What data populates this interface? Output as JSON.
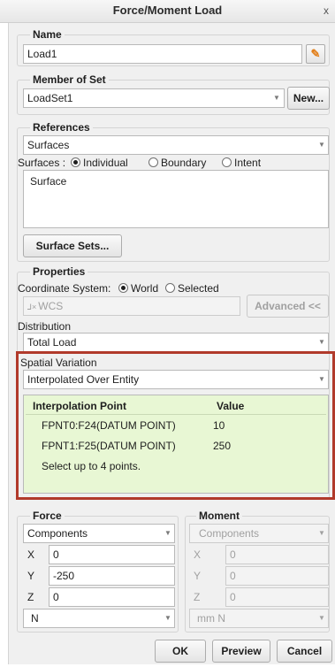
{
  "window": {
    "title": "Force/Moment Load",
    "close": "x"
  },
  "name_group": {
    "legend": "Name",
    "value": "Load1"
  },
  "member_group": {
    "legend": "Member of Set",
    "value": "LoadSet1",
    "new_button": "New..."
  },
  "references": {
    "legend": "References",
    "type_value": "Surfaces",
    "surfaces_label": "Surfaces :",
    "radio_options": [
      "Individual",
      "Boundary",
      "Intent"
    ],
    "radio_selected": "Individual",
    "list_item": "Surface",
    "surface_sets_button": "Surface Sets..."
  },
  "properties": {
    "legend": "Properties",
    "coord_label": "Coordinate System:",
    "coord_options": [
      "World",
      "Selected"
    ],
    "coord_selected": "World",
    "wcs_value": "WCS",
    "advanced_button": "Advanced <<",
    "distribution_label": "Distribution",
    "distribution_value": "Total Load",
    "spatial_label": "Spatial Variation",
    "spatial_value": "Interpolated Over Entity"
  },
  "interpolation_table": {
    "headers": [
      "Interpolation Point",
      "Value"
    ],
    "rows": [
      {
        "point": "FPNT0:F24(DATUM POINT)",
        "value": "10"
      },
      {
        "point": "FPNT1:F25(DATUM POINT)",
        "value": "250"
      }
    ],
    "hint": "Select up to 4 points."
  },
  "force": {
    "legend": "Force",
    "mode": "Components",
    "x_label": "X",
    "x_value": "0",
    "y_label": "Y",
    "y_value": "-250",
    "z_label": "Z",
    "z_value": "0",
    "units": "N"
  },
  "moment": {
    "legend": "Moment",
    "mode": "Components",
    "x_label": "X",
    "x_value": "0",
    "y_label": "Y",
    "y_value": "0",
    "z_label": "Z",
    "z_value": "0",
    "units": "mm N"
  },
  "footer": {
    "ok": "OK",
    "preview": "Preview",
    "cancel": "Cancel"
  },
  "colors": {
    "highlight_border": "#b13a2b",
    "table_bg": "#e8f7d4",
    "pencil_icon": "#e2801c"
  }
}
